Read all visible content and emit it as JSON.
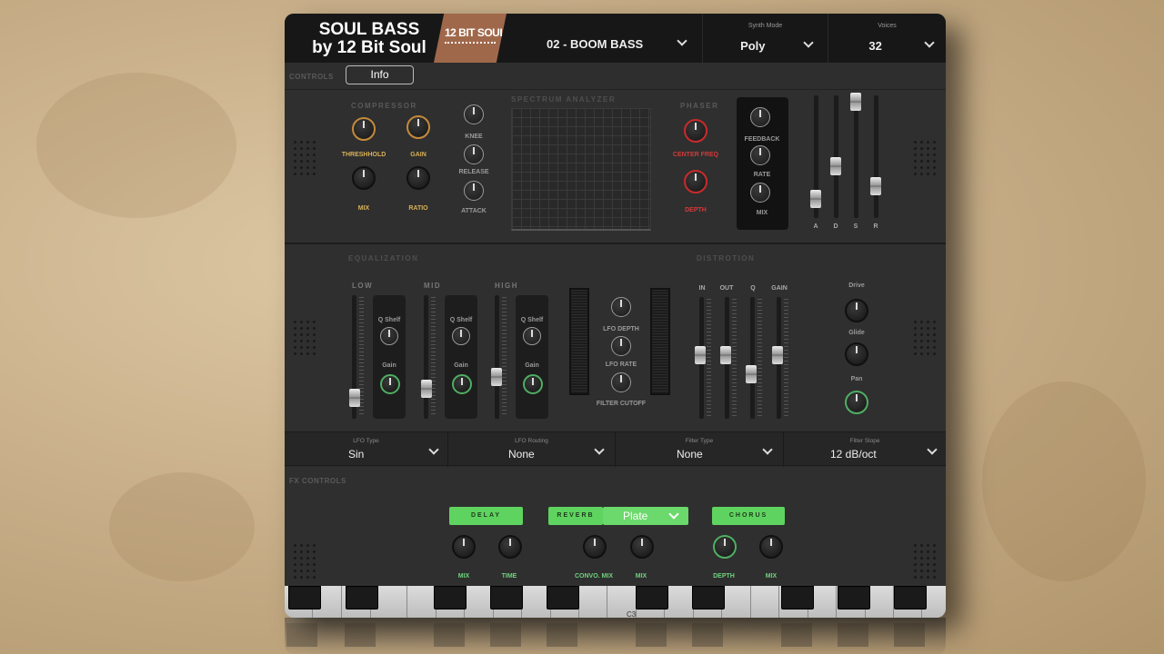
{
  "header": {
    "logo_title_line1": "SOUL BASS",
    "logo_title_line2": "by 12 Bit Soul",
    "logo_badge": "12 BIT SOUL",
    "preset": "02 - BOOM BASS",
    "synth_mode_label": "Synth Mode",
    "synth_mode_value": "Poly",
    "voices_label": "Voices",
    "voices_value": "32"
  },
  "controls_bar": {
    "section_label": "CONTROLS",
    "info_button": "Info"
  },
  "compressor": {
    "title": "COMPRESSOR",
    "threshold": "THRESHHOLD",
    "gain": "GAIN",
    "mix": "MIX",
    "ratio": "RATIO",
    "knee": "KNEE",
    "release": "RELEASE",
    "attack": "ATTACK"
  },
  "spectrum": {
    "title": "SPECTRUM ANALYZER"
  },
  "phaser": {
    "title": "PHASER",
    "center_freq": "CENTER FREQ",
    "depth": "DEPTH",
    "feedback": "FEEDBACK",
    "rate": "RATE",
    "mix": "MIX"
  },
  "adsr": {
    "labels": [
      "A",
      "D",
      "S",
      "R"
    ]
  },
  "equalization": {
    "title": "EQUALIZATION",
    "bands": [
      {
        "name": "LOW",
        "q_label": "Q Shelf",
        "gain_label": "Gain"
      },
      {
        "name": "MID",
        "q_label": "Q Shelf",
        "gain_label": "Gain"
      },
      {
        "name": "HIGH",
        "q_label": "Q Shelf",
        "gain_label": "Gain"
      }
    ],
    "lfo_depth": "LFO DEPTH",
    "lfo_rate": "LFO RATE",
    "filter_cutoff": "FILTER CUTOFF"
  },
  "distortion": {
    "title": "DISTROTION",
    "labels": [
      "IN",
      "OUT",
      "Q",
      "GAIN"
    ],
    "drive": "Drive",
    "glide": "Glide",
    "pan": "Pan"
  },
  "selectors": [
    {
      "label": "LFO Type",
      "value": "Sin"
    },
    {
      "label": "LFO Routing",
      "value": "None"
    },
    {
      "label": "Filter Type",
      "value": "None"
    },
    {
      "label": "Filter Slope",
      "value": "12 dB/oct"
    }
  ],
  "fx": {
    "section_label": "FX CONTROLS",
    "delay": "DELAY",
    "reverb": "REVERB",
    "reverb_type": "Plate",
    "chorus": "CHORUS",
    "delay_mix": "MIX",
    "delay_time": "TIME",
    "reverb_convo_mix": "CONVO. MIX",
    "reverb_mix": "MIX",
    "chorus_depth": "DEPTH",
    "chorus_mix": "MIX"
  },
  "keyboard": {
    "marker": "C3"
  },
  "colors": {
    "accent_green": "#5fd35f",
    "accent_gold": "#d9b157",
    "accent_red": "#d33a3a",
    "badge_copper": "#a0684b"
  }
}
